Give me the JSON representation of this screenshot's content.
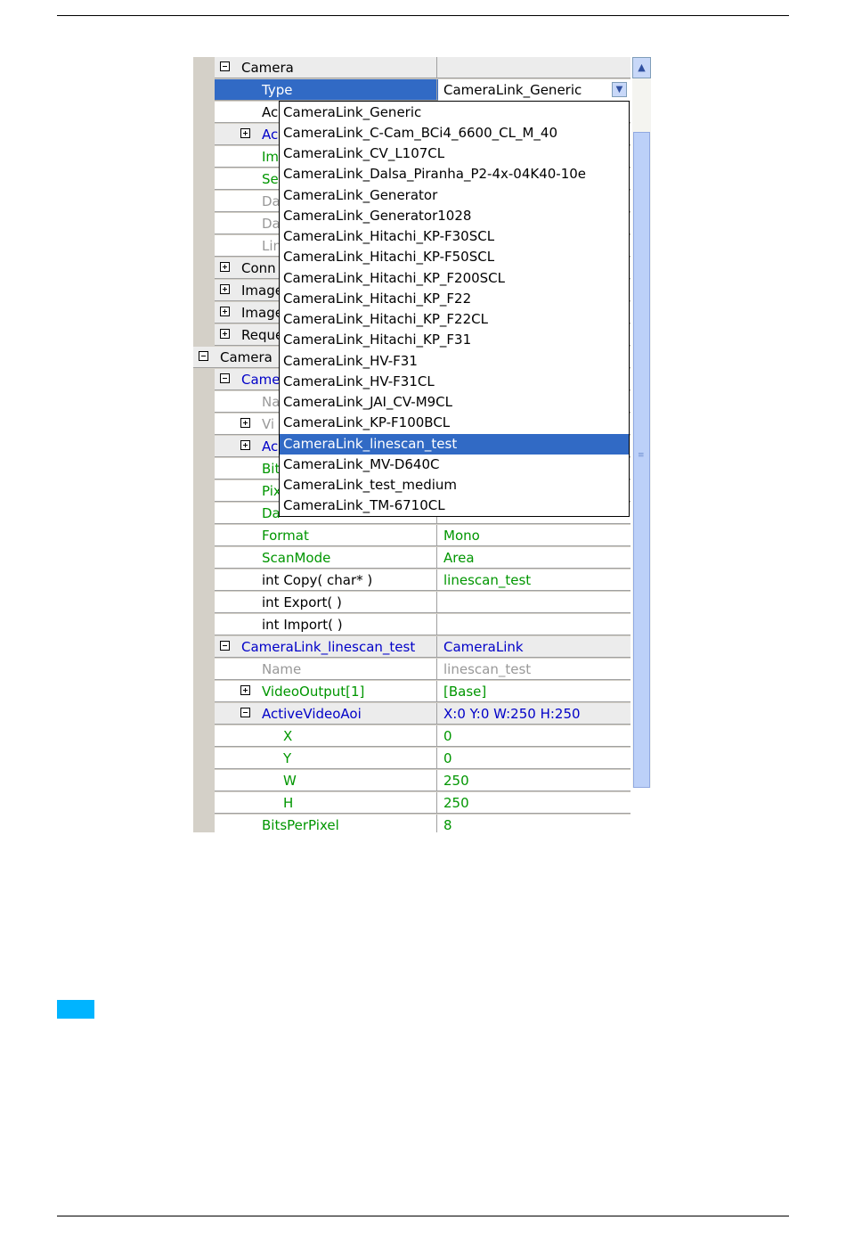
{
  "property_grid": {
    "rows": [
      {
        "name": "Camera",
        "value": "",
        "toggle": "minus"
      },
      {
        "name": "Type",
        "value": "CameraLink_Generic",
        "selected": true
      },
      {
        "name": "Ac"
      },
      {
        "name": "Ac",
        "toggle": "plus"
      },
      {
        "name": "Im"
      },
      {
        "name": "Se"
      },
      {
        "name": "Da"
      },
      {
        "name": "Da"
      },
      {
        "name": "Lin"
      },
      {
        "name": "Conn",
        "toggle": "plus"
      },
      {
        "name": "Image",
        "toggle": "plus"
      },
      {
        "name": "Image",
        "toggle": "plus"
      },
      {
        "name": "Reque",
        "toggle": "plus"
      },
      {
        "name": "Camera",
        "toggle": "minus"
      },
      {
        "name": "Came",
        "toggle": "minus"
      },
      {
        "name": "Na"
      },
      {
        "name": "Vi",
        "toggle": "plus"
      },
      {
        "name": "Ac",
        "toggle": "plus"
      },
      {
        "name": "Bit"
      },
      {
        "name": "Pix"
      },
      {
        "name": "Da"
      },
      {
        "name": "Format",
        "value": "Mono"
      },
      {
        "name": "ScanMode",
        "value": "Area"
      },
      {
        "name": "int Copy( char* )",
        "value": "linescan_test"
      },
      {
        "name": "int Export( )",
        "value": ""
      },
      {
        "name": "int Import( )",
        "value": ""
      },
      {
        "name": "CameraLink_linescan_test",
        "value": "CameraLink",
        "toggle": "minus"
      },
      {
        "name": "Name",
        "value": "linescan_test"
      },
      {
        "name": "VideoOutput[1]",
        "value": "[Base]",
        "toggle": "plus"
      },
      {
        "name": "ActiveVideoAoi",
        "value": "X:0 Y:0 W:250 H:250",
        "toggle": "minus"
      },
      {
        "name": "X",
        "value": "0"
      },
      {
        "name": "Y",
        "value": "0"
      },
      {
        "name": "W",
        "value": "250"
      },
      {
        "name": "H",
        "value": "250"
      },
      {
        "name": "BitsPerPixel",
        "value": "8"
      }
    ]
  },
  "dropdown": {
    "options": [
      "CameraLink_Generic",
      "CameraLink_C-Cam_BCi4_6600_CL_M_40",
      "CameraLink_CV_L107CL",
      "CameraLink_Dalsa_Piranha_P2-4x-04K40-10e",
      "CameraLink_Generator",
      "CameraLink_Generator1028",
      "CameraLink_Hitachi_KP-F30SCL",
      "CameraLink_Hitachi_KP-F50SCL",
      "CameraLink_Hitachi_KP_F200SCL",
      "CameraLink_Hitachi_KP_F22",
      "CameraLink_Hitachi_KP_F22CL",
      "CameraLink_Hitachi_KP_F31",
      "CameraLink_HV-F31",
      "CameraLink_HV-F31CL",
      "CameraLink_JAI_CV-M9CL",
      "CameraLink_KP-F100BCL",
      "CameraLink_linescan_test",
      "CameraLink_MV-D640C",
      "CameraLink_test_medium",
      "CameraLink_TM-6710CL"
    ],
    "selected": "CameraLink_linescan_test"
  },
  "icons": {
    "combo_arrow": "chevron-down-icon",
    "scroll_up": "chevron-up-icon",
    "scroll_grip": "grip-icon"
  },
  "colors": {
    "selection": "#316ac5",
    "category_text": "#0000c8",
    "value_text": "#009600",
    "disabled_text": "#999999",
    "marker": "#00b4ff"
  }
}
